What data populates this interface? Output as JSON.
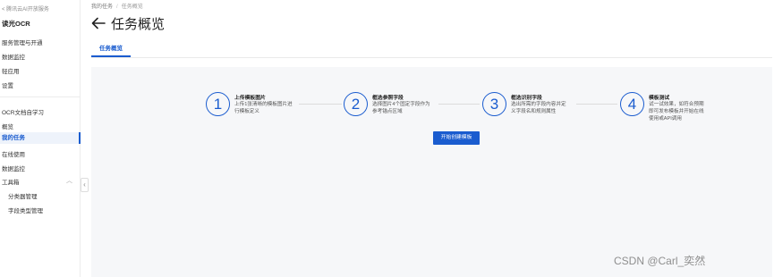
{
  "sidebar": {
    "back_link": "< 腾讯云AI开放服务",
    "app_name": "读光OCR",
    "items_top": [
      "服务管理与开通",
      "数据监控",
      "轻应用",
      "设置"
    ],
    "items_section": [
      "OCR文档自学习",
      "概览"
    ],
    "active_item": "我的任务",
    "items_bottom": [
      "在线使用",
      "数据监控",
      "工具箱"
    ],
    "sub_items": [
      "分类器管理",
      "字段类型管理"
    ],
    "collapse_glyph": "‹",
    "chevron_glyph": "︿"
  },
  "breadcrumb": {
    "first": "我的任务",
    "separator": "/",
    "current": "任务概览"
  },
  "page": {
    "title": "任务概览",
    "tab": "任务概览"
  },
  "steps": [
    {
      "number": "1",
      "title": "上传模板图片",
      "desc": "上传1张清晰的模板图片进行模板定义"
    },
    {
      "number": "2",
      "title": "框选参照字段",
      "desc": "选择图片4个固定字段作为参考锚点区域"
    },
    {
      "number": "3",
      "title": "框选识别字段",
      "desc": "选出所需的字段内容并定义字段名和规则属性"
    },
    {
      "number": "4",
      "title": "模板测试",
      "desc": "试一试效果，如符合预期即可发布模板并开始在线使用或API调用"
    }
  ],
  "start_button": "开始创建模板",
  "watermark": "CSDN @Carl_奕然",
  "colors": {
    "accent": "#1a5ccf",
    "panel_bg": "#f6f7f9"
  }
}
